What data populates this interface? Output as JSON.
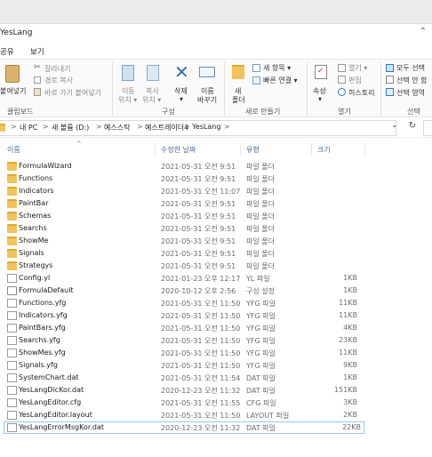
{
  "window": {
    "title": "YesLang"
  },
  "menu": {
    "items": [
      "공유",
      "보기"
    ]
  },
  "ribbon": {
    "clipboard": {
      "paste_label": "붙여넣기",
      "cut": "잘라내기",
      "copy_path": "경로 복사",
      "paste_shortcut": "바로 가기 붙여넣기",
      "group_label": "클립보드"
    },
    "organize": {
      "move_to": [
        "이동",
        "위치 ▾"
      ],
      "copy_to": [
        "복사",
        "위치 ▾"
      ],
      "delete": [
        "삭제",
        "▾"
      ],
      "rename": [
        "이름",
        "바꾸기"
      ],
      "group_label": "구성"
    },
    "new": {
      "new_folder": [
        "새",
        "폴더"
      ],
      "new_item": "새 항목 ▾",
      "easy_access": "빠른 연결 ▾",
      "group_label": "새로 만들기"
    },
    "open": {
      "properties": [
        "속성",
        "▾"
      ],
      "open": "열기 ▾",
      "edit": "편집",
      "history": "히스토리",
      "group_label": "열기"
    },
    "select": {
      "select_all": "모두 선택",
      "select_none": "선택 안 함",
      "invert": "선택 영역",
      "group_label": "선택"
    }
  },
  "address": {
    "crumbs": [
      "내 PC",
      "새 볼륨 (D:)",
      "예스스탁",
      "예스트레이더4",
      "YesLang"
    ],
    "separator": ">"
  },
  "columns": {
    "name": "이름",
    "date": "수정한 날짜",
    "type": "유형",
    "size": "크기"
  },
  "files": [
    {
      "name": "FormulaWizard",
      "date": "2021-05-31 오전 9:51",
      "type": "파일 폴더",
      "size": "",
      "kind": "folder"
    },
    {
      "name": "Functions",
      "date": "2021-05-31 오전 9:51",
      "type": "파일 폴더",
      "size": "",
      "kind": "folder"
    },
    {
      "name": "Indicators",
      "date": "2021-05-31 오전 11:07",
      "type": "파일 폴더",
      "size": "",
      "kind": "folder"
    },
    {
      "name": "PaintBar",
      "date": "2021-05-31 오전 9:51",
      "type": "파일 폴더",
      "size": "",
      "kind": "folder"
    },
    {
      "name": "Schemas",
      "date": "2021-05-31 오전 9:51",
      "type": "파일 폴더",
      "size": "",
      "kind": "folder"
    },
    {
      "name": "Searchs",
      "date": "2021-05-31 오전 9:51",
      "type": "파일 폴더",
      "size": "",
      "kind": "folder"
    },
    {
      "name": "ShowMe",
      "date": "2021-05-31 오전 9:51",
      "type": "파일 폴더",
      "size": "",
      "kind": "folder"
    },
    {
      "name": "Signals",
      "date": "2021-05-31 오전 9:51",
      "type": "파일 폴더",
      "size": "",
      "kind": "folder"
    },
    {
      "name": "Strategys",
      "date": "2021-05-31 오전 9:51",
      "type": "파일 폴더",
      "size": "",
      "kind": "folder"
    },
    {
      "name": "Config.yl",
      "date": "2021-01-23 오후 12:17",
      "type": "YL 파일",
      "size": "1KB",
      "kind": "doc"
    },
    {
      "name": "FormulaDefault",
      "date": "2020-10-12 오후 2:56",
      "type": "구성 설정",
      "size": "1KB",
      "kind": "gear"
    },
    {
      "name": "Functions.yfg",
      "date": "2021-05-31 오전 11:50",
      "type": "YFG 파일",
      "size": "11KB",
      "kind": "doc"
    },
    {
      "name": "Indicators.yfg",
      "date": "2021-05-31 오전 11:50",
      "type": "YFG 파일",
      "size": "11KB",
      "kind": "doc"
    },
    {
      "name": "PaintBars.yfg",
      "date": "2021-05-31 오전 11:50",
      "type": "YFG 파일",
      "size": "4KB",
      "kind": "doc"
    },
    {
      "name": "Searchs.yfg",
      "date": "2021-05-31 오전 11:50",
      "type": "YFG 파일",
      "size": "23KB",
      "kind": "doc"
    },
    {
      "name": "ShowMes.yfg",
      "date": "2021-05-31 오전 11:50",
      "type": "YFG 파일",
      "size": "11KB",
      "kind": "doc"
    },
    {
      "name": "Signals.yfg",
      "date": "2021-05-31 오전 11:50",
      "type": "YFG 파일",
      "size": "9KB",
      "kind": "doc"
    },
    {
      "name": "SystemChart.dat",
      "date": "2021-05-31 오전 11:54",
      "type": "DAT 파일",
      "size": "1KB",
      "kind": "doc"
    },
    {
      "name": "YesLangDicKor.dat",
      "date": "2020-12-23 오전 11:32",
      "type": "DAT 파일",
      "size": "151KB",
      "kind": "doc"
    },
    {
      "name": "YesLangEditor.cfg",
      "date": "2021-05-31 오전 11:55",
      "type": "CFG 파일",
      "size": "3KB",
      "kind": "doc"
    },
    {
      "name": "YesLangEditor.layout",
      "date": "2021-05-31 오전 11:50",
      "type": "LAYOUT 파일",
      "size": "2KB",
      "kind": "doc"
    },
    {
      "name": "YesLangErrorMsgKor.dat",
      "date": "2020-12-23 오전 11:32",
      "type": "DAT 파일",
      "size": "22KB",
      "kind": "doc",
      "selected": true
    }
  ],
  "colors": {
    "folder": "#f2c35a",
    "selection_border": "#99c9ef",
    "header_text": "#4a6a8a",
    "accent_blue": "#2b7bd8"
  }
}
